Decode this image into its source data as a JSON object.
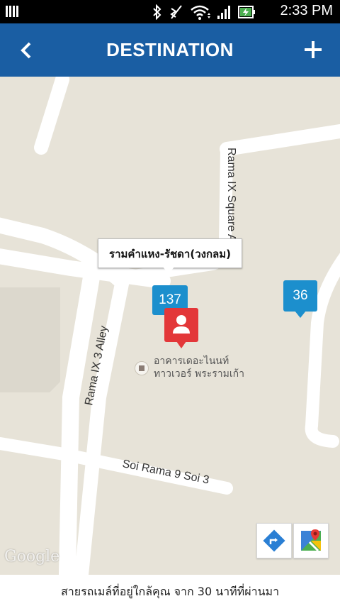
{
  "status_bar": {
    "time": "2:33 PM",
    "icons": [
      "bluetooth-icon",
      "vibrate-off-icon",
      "wifi-icon",
      "signal-icon",
      "battery-charging-icon"
    ]
  },
  "app_bar": {
    "title": "DESTINATION",
    "back_icon": "chevron-left-icon",
    "add_icon": "plus-icon"
  },
  "map": {
    "streets": {
      "square_alley": "Rama IX Square Alley",
      "rama9_3_alley": "Rama IX 3 Alley",
      "soi_rama9_3": "Soi Rama 9 Soi 3"
    },
    "callout_label": "รามคำแหง-รัชดา(วงกลม)",
    "bus_markers": [
      {
        "label": "137"
      },
      {
        "label": "36"
      }
    ],
    "poi": {
      "line1": "อาคารเดอะไนนท์",
      "line2": "ทาวเวอร์ พระรามเก้า"
    },
    "watermark": "Google"
  },
  "footer": {
    "text": "สายรถเมล์ที่อยู่ใกล้คุณ จาก 30 นาทีที่ผ่านมา"
  },
  "colors": {
    "app_bar": "#1a5ea3",
    "map_bg": "#e7e3d8",
    "bus_marker": "#1c8fcd",
    "user_pin": "#e33739"
  }
}
